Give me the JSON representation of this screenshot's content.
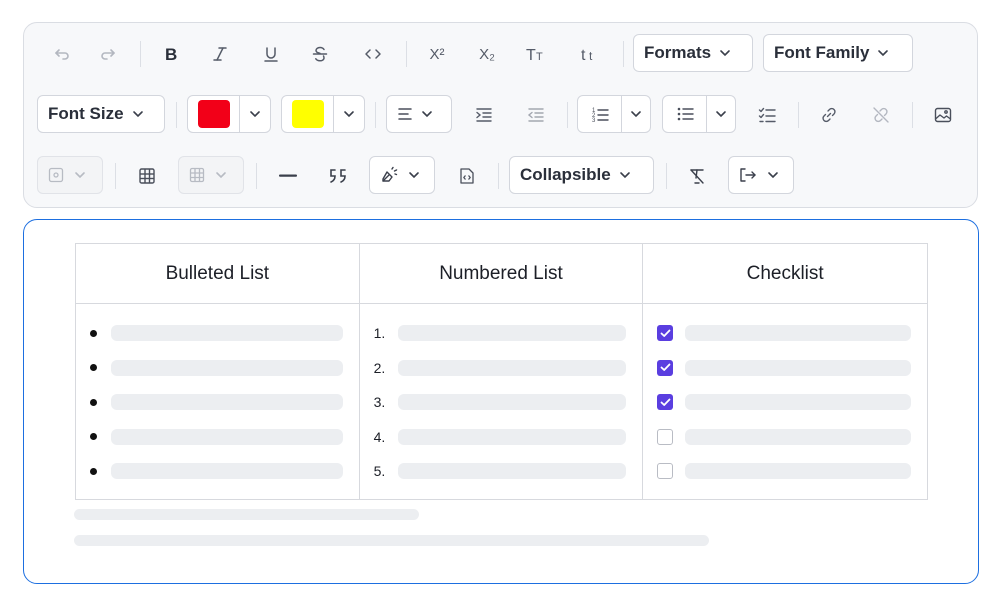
{
  "toolbar": {
    "formats_label": "Formats",
    "font_family_label": "Font Family",
    "font_size_label": "Font Size",
    "collapsible_label": "Collapsible",
    "superscript_label": "X²",
    "subscript_label": "X₂",
    "text_color": "#f20018",
    "highlight_color": "#ffff00",
    "icons": [
      "undo-icon",
      "redo-icon",
      "bold-icon",
      "italic-icon",
      "underline-icon",
      "strikethrough-icon",
      "code-icon",
      "superscript-icon",
      "subscript-icon",
      "uppercase-icon",
      "lowercase-icon",
      "align-icon",
      "indent-icon",
      "outdent-icon",
      "numbered-list-icon",
      "bulleted-list-icon",
      "checklist-icon",
      "link-icon",
      "unlink-icon",
      "image-icon",
      "image-settings-icon",
      "table-icon",
      "table-settings-icon",
      "horizontal-rule-icon",
      "blockquote-icon",
      "clear-style-icon",
      "code-block-icon",
      "clear-formatting-icon",
      "export-icon"
    ]
  },
  "editor": {
    "table": {
      "headers": [
        "Bulleted List",
        "Numbered List",
        "Checklist"
      ],
      "bulleted_items": 5,
      "numbered_items": [
        "1.",
        "2.",
        "3.",
        "4.",
        "5."
      ],
      "checklist": [
        true,
        true,
        true,
        false,
        false
      ]
    }
  }
}
